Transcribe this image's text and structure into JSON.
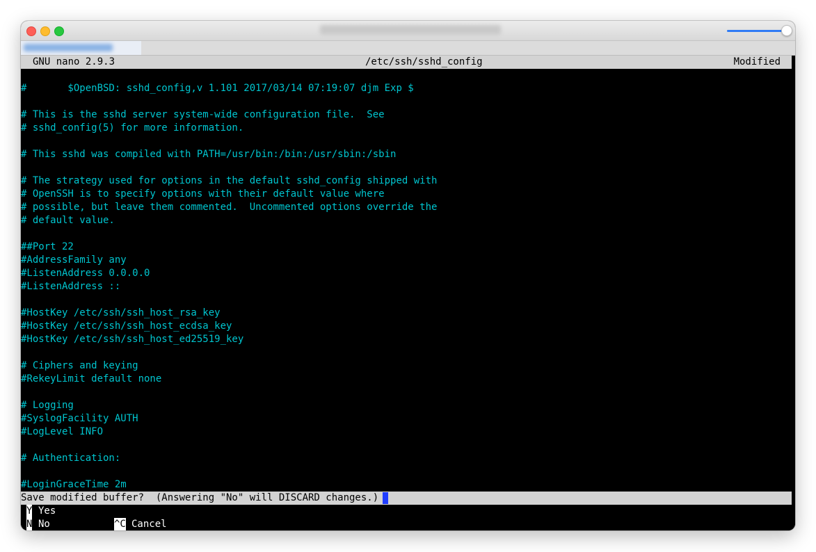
{
  "nano": {
    "version": "GNU nano 2.9.3",
    "filename": "/etc/ssh/sshd_config",
    "status": "Modified"
  },
  "lines": [
    "#       $OpenBSD: sshd_config,v 1.101 2017/03/14 07:19:07 djm Exp $",
    "",
    "# This is the sshd server system-wide configuration file.  See",
    "# sshd_config(5) for more information.",
    "",
    "# This sshd was compiled with PATH=/usr/bin:/bin:/usr/sbin:/sbin",
    "",
    "# The strategy used for options in the default sshd_config shipped with",
    "# OpenSSH is to specify options with their default value where",
    "# possible, but leave them commented.  Uncommented options override the",
    "# default value.",
    "",
    "##Port 22",
    "#AddressFamily any",
    "#ListenAddress 0.0.0.0",
    "#ListenAddress ::",
    "",
    "#HostKey /etc/ssh/ssh_host_rsa_key",
    "#HostKey /etc/ssh/ssh_host_ecdsa_key",
    "#HostKey /etc/ssh/ssh_host_ed25519_key",
    "",
    "# Ciphers and keying",
    "#RekeyLimit default none",
    "",
    "# Logging",
    "#SyslogFacility AUTH",
    "#LogLevel INFO",
    "",
    "# Authentication:",
    "",
    "#LoginGraceTime 2m"
  ],
  "prompt": {
    "text": "Save modified buffer?  (Answering \"No\" will DISCARD changes.)"
  },
  "options": {
    "yes_key": "Y",
    "yes_label": "Yes",
    "no_key": "N",
    "no_label": "No",
    "cancel_key": "^C",
    "cancel_label": "Cancel"
  },
  "colors": {
    "text": "#00c5cf",
    "bar": "#d3d3d3",
    "cursor": "#1f3cff"
  }
}
